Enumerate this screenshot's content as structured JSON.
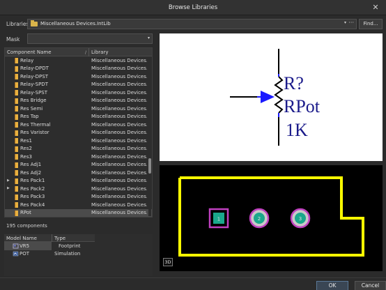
{
  "window": {
    "title": "Browse Libraries",
    "close_glyph": "✕"
  },
  "libraries": {
    "label": "Libraries",
    "selected": "Miscellaneous Devices.IntLib",
    "dropdown_glyph": "▾",
    "more_glyph": "···",
    "find_label": "Find..."
  },
  "mask": {
    "label": "Mask",
    "value": "",
    "dropdown_glyph": "▾"
  },
  "component_list": {
    "headers": {
      "name": "Component Name",
      "library": "Library",
      "sort_glyph": "/"
    },
    "rows": [
      {
        "name": "Relay",
        "library": "Miscellaneous Devices.Int",
        "expandable": false,
        "selected": false
      },
      {
        "name": "Relay-DPDT",
        "library": "Miscellaneous Devices.Int",
        "expandable": false,
        "selected": false
      },
      {
        "name": "Relay-DPST",
        "library": "Miscellaneous Devices.Int",
        "expandable": false,
        "selected": false
      },
      {
        "name": "Relay-SPDT",
        "library": "Miscellaneous Devices.Int",
        "expandable": false,
        "selected": false
      },
      {
        "name": "Relay-SPST",
        "library": "Miscellaneous Devices.Int",
        "expandable": false,
        "selected": false
      },
      {
        "name": "Res Bridge",
        "library": "Miscellaneous Devices.Int",
        "expandable": false,
        "selected": false
      },
      {
        "name": "Res Semi",
        "library": "Miscellaneous Devices.Int",
        "expandable": false,
        "selected": false
      },
      {
        "name": "Res Tap",
        "library": "Miscellaneous Devices.Int",
        "expandable": false,
        "selected": false
      },
      {
        "name": "Res Thermal",
        "library": "Miscellaneous Devices.Int",
        "expandable": false,
        "selected": false
      },
      {
        "name": "Res Varistor",
        "library": "Miscellaneous Devices.Int",
        "expandable": false,
        "selected": false
      },
      {
        "name": "Res1",
        "library": "Miscellaneous Devices.Int",
        "expandable": false,
        "selected": false
      },
      {
        "name": "Res2",
        "library": "Miscellaneous Devices.Int",
        "expandable": false,
        "selected": false
      },
      {
        "name": "Res3",
        "library": "Miscellaneous Devices.Int",
        "expandable": false,
        "selected": false
      },
      {
        "name": "Res Adj1",
        "library": "Miscellaneous Devices.Int",
        "expandable": false,
        "selected": false
      },
      {
        "name": "Res Adj2",
        "library": "Miscellaneous Devices.Int",
        "expandable": false,
        "selected": false
      },
      {
        "name": "Res Pack1",
        "library": "Miscellaneous Devices.Int",
        "expandable": true,
        "selected": false
      },
      {
        "name": "Res Pack2",
        "library": "Miscellaneous Devices.Int",
        "expandable": true,
        "selected": false
      },
      {
        "name": "Res Pack3",
        "library": "Miscellaneous Devices.Int",
        "expandable": false,
        "selected": false
      },
      {
        "name": "Res Pack4",
        "library": "Miscellaneous Devices.Int",
        "expandable": false,
        "selected": false
      },
      {
        "name": "RPot",
        "library": "Miscellaneous Devices.Int",
        "expandable": false,
        "selected": true
      }
    ],
    "count_text": "195 components"
  },
  "models": {
    "headers": {
      "name": "Model Name",
      "type": "Type"
    },
    "rows": [
      {
        "name": "VR5",
        "type": "Footprint",
        "icon": "footprint-icon",
        "selected": true
      },
      {
        "name": "POT",
        "type": "Simulation",
        "icon": "simulation-icon",
        "selected": false
      }
    ]
  },
  "preview": {
    "designator": "R?",
    "comment": "RPot",
    "value": "1K",
    "pads": [
      "1",
      "2",
      "3"
    ],
    "view_toggle": "3D",
    "colors": {
      "wire": "#000000",
      "pin": "#1a1aff",
      "pcb_outline": "#ffff00",
      "pad_ring": "#b040b0",
      "pad_fill": "#20a090"
    }
  },
  "footer": {
    "ok_label": "OK",
    "cancel_label": "Cancel"
  }
}
